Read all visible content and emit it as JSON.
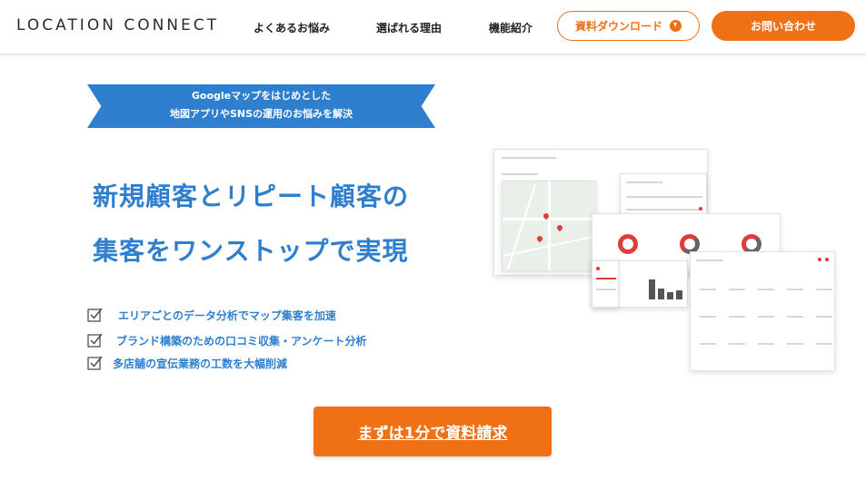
{
  "header": {
    "logo": "LOCATION CONNECT",
    "nav": [
      "よくあるお悩み",
      "選ばれる理由",
      "機能紹介"
    ],
    "download_label": "資料ダウンロード",
    "contact_label": "お問い合わせ"
  },
  "hero": {
    "ribbon_line1": "Googleマップをはじめとした",
    "ribbon_line2": "地図アプリやSNSの運用のお悩みを解決",
    "headline_line1": "新規顧客とリピート顧客の",
    "headline_line2": "集客をワンストップで実現",
    "features": [
      "エリアごとのデータ分析でマップ集客を加速",
      "ブランド構築のための口コミ収集・アンケート分析",
      "多店舗の宣伝業務の工数を大幅削減"
    ],
    "cta_label": "まずは1分で資料請求"
  },
  "colors": {
    "accent_orange": "#f07016",
    "brand_blue": "#2f7fcf"
  }
}
